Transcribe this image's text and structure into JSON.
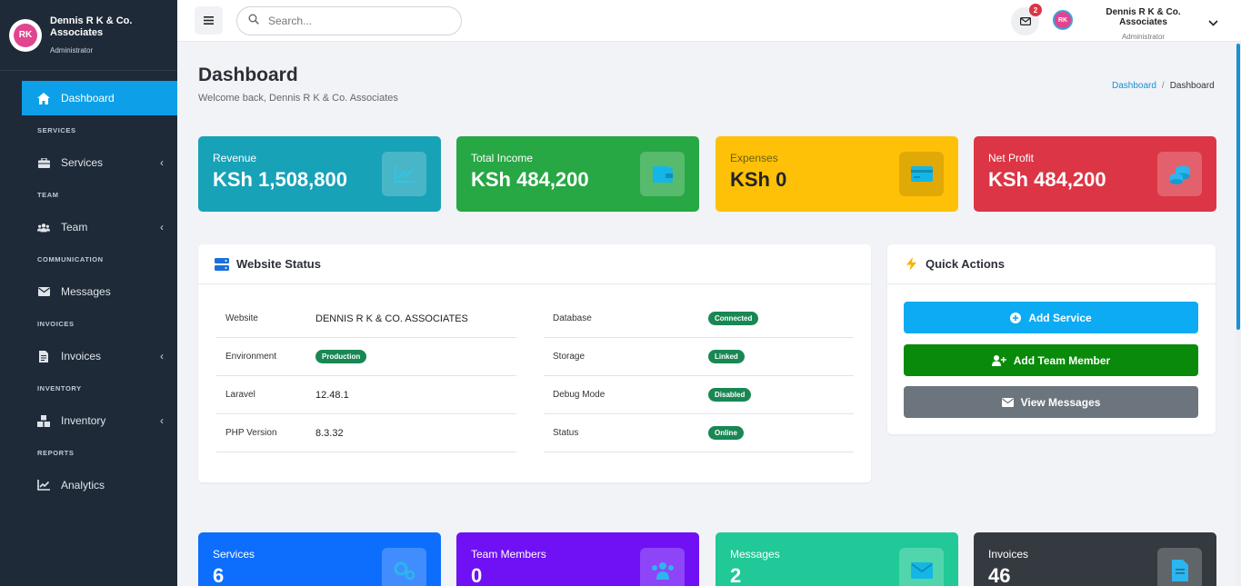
{
  "brand": {
    "name": "Dennis R K & Co. Associates",
    "role": "Administrator",
    "logo_initials": "RK"
  },
  "sidebar": {
    "active": {
      "label": "Dashboard",
      "icon": "home-icon"
    },
    "sections": [
      {
        "title": "SERVICES",
        "item": {
          "label": "Services",
          "icon": "briefcase-icon",
          "has_submenu": true
        }
      },
      {
        "title": "TEAM",
        "item": {
          "label": "Team",
          "icon": "users-icon",
          "has_submenu": true
        }
      },
      {
        "title": "COMMUNICATION",
        "item": {
          "label": "Messages",
          "icon": "envelope-icon",
          "has_submenu": false
        }
      },
      {
        "title": "INVOICES",
        "item": {
          "label": "Invoices",
          "icon": "file-invoice-icon",
          "has_submenu": true
        }
      },
      {
        "title": "INVENTORY",
        "item": {
          "label": "Inventory",
          "icon": "boxes-icon",
          "has_submenu": true
        }
      },
      {
        "title": "REPORTS",
        "item": {
          "label": "Analytics",
          "icon": "chart-line-icon",
          "has_submenu": false
        }
      }
    ],
    "chevron": "‹"
  },
  "topbar": {
    "search_placeholder": "Search...",
    "mail_badge": "2",
    "user_name": "Dennis R K & Co. Associates",
    "user_role": "Administrator"
  },
  "header": {
    "title": "Dashboard",
    "subtitle": "Welcome back, Dennis R K & Co. Associates",
    "breadcrumb_link": "Dashboard",
    "breadcrumb_sep": "/",
    "breadcrumb_current": "Dashboard"
  },
  "stats_top": [
    {
      "label": "Revenue",
      "value": "KSh 1,508,800",
      "color": "#17a2b8",
      "icon": "chart-line-icon"
    },
    {
      "label": "Total Income",
      "value": "KSh 484,200",
      "color": "#28a745",
      "icon": "wallet-icon"
    },
    {
      "label": "Expenses",
      "value": "KSh 0",
      "color": "#ffc107",
      "icon": "credit-card-icon"
    },
    {
      "label": "Net Profit",
      "value": "KSh 484,200",
      "color": "#dc3545",
      "icon": "coins-icon"
    }
  ],
  "website_status": {
    "title": "Website Status",
    "left": [
      {
        "key": "Website",
        "value": "DENNIS R K & CO. ASSOCIATES",
        "pill": false
      },
      {
        "key": "Environment",
        "value": "Production",
        "pill": true
      },
      {
        "key": "Laravel",
        "value": "12.48.1",
        "pill": false
      },
      {
        "key": "PHP Version",
        "value": "8.3.32",
        "pill": false
      }
    ],
    "right": [
      {
        "key": "Database",
        "value": "Connected",
        "pill": true
      },
      {
        "key": "Storage",
        "value": "Linked",
        "pill": true
      },
      {
        "key": "Debug Mode",
        "value": "Disabled",
        "pill": true
      },
      {
        "key": "Status",
        "value": "Online",
        "pill": true
      }
    ]
  },
  "quick_actions": {
    "title": "Quick Actions",
    "buttons": [
      {
        "label": "Add Service",
        "color": "#0dabf3",
        "icon": "plus-circle-icon"
      },
      {
        "label": "Add Team Member",
        "color": "#0a8a0a",
        "icon": "user-plus-icon"
      },
      {
        "label": "View Messages",
        "color": "#6c757d",
        "icon": "envelope-icon"
      }
    ]
  },
  "stats_bottom": [
    {
      "label": "Services",
      "value": "6",
      "color": "#0d6efd",
      "icon": "cogs-icon"
    },
    {
      "label": "Team Members",
      "value": "0",
      "color": "#6f10f5",
      "icon": "users-icon"
    },
    {
      "label": "Messages",
      "value": "2",
      "color": "#20c997",
      "icon": "envelope-icon"
    },
    {
      "label": "Invoices",
      "value": "46",
      "color": "#343a40",
      "icon": "file-invoice-icon"
    }
  ]
}
